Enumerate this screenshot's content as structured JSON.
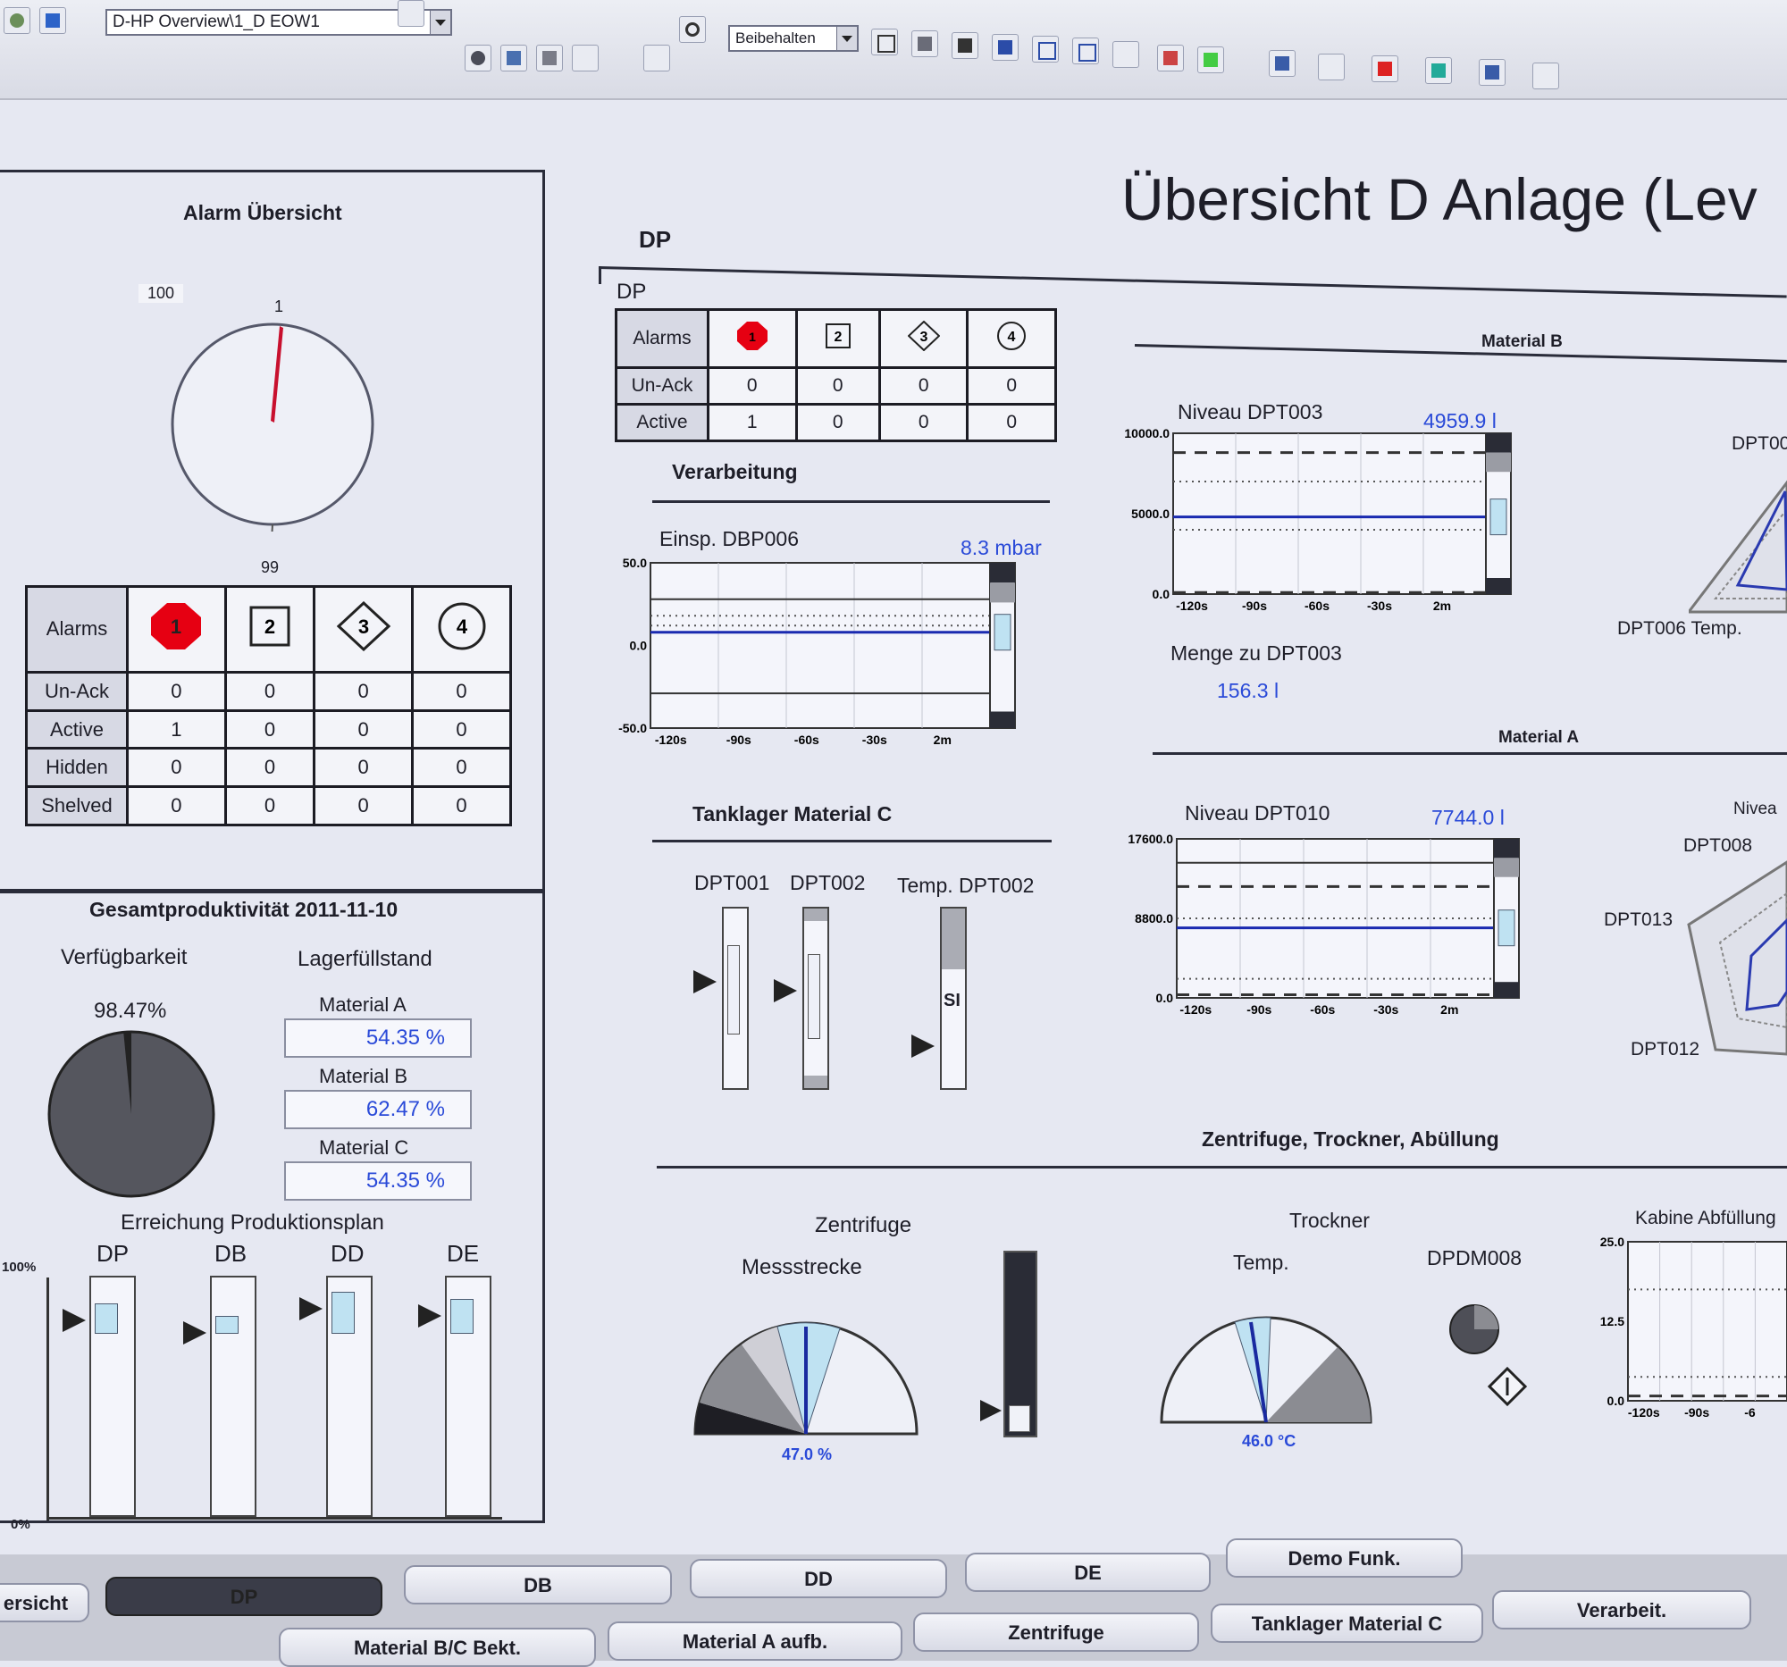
{
  "toolbar": {
    "screen_combo": "D-HP Overview\\1_D EOW1",
    "mode_combo": "Beibehalten"
  },
  "page_title": "Übersicht D Anlage (Lev",
  "alarm_overview": {
    "title": "Alarm Übersicht",
    "gauge_max": "100",
    "gauge_mark_top": "1",
    "gauge_mark_bottom": "99",
    "headers": [
      "Alarms",
      "1",
      "2",
      "3",
      "4"
    ],
    "rows": [
      {
        "label": "Un-Ack",
        "values": [
          "0",
          "0",
          "0",
          "0"
        ]
      },
      {
        "label": "Active",
        "values": [
          "1",
          "0",
          "0",
          "0"
        ]
      },
      {
        "label": "Hidden",
        "values": [
          "0",
          "0",
          "0",
          "0"
        ]
      },
      {
        "label": "Shelved",
        "values": [
          "0",
          "0",
          "0",
          "0"
        ]
      }
    ]
  },
  "productivity": {
    "title": "Gesamtproduktivität 2011-11-10",
    "availability_label": "Verfügbarkeit",
    "availability_value": "98.47%",
    "availability_fraction": 0.9847,
    "storage_label": "Lagerfüllstand",
    "materials": [
      {
        "name": "Material A",
        "value": "54.35 %"
      },
      {
        "name": "Material B",
        "value": "62.47 %"
      },
      {
        "name": "Material C",
        "value": "54.35 %"
      }
    ],
    "plan_title": "Erreichung Produktionsplan",
    "axis_top": "100%",
    "axis_bottom": "0%",
    "plan_bars": [
      {
        "name": "DP",
        "level": 0.9
      },
      {
        "name": "DB",
        "level": 0.85
      },
      {
        "name": "DD",
        "level": 0.95
      },
      {
        "name": "DE",
        "level": 0.92
      }
    ]
  },
  "dp": {
    "section_label": "DP",
    "box_label": "DP",
    "headers": [
      "Alarms",
      "1",
      "2",
      "3",
      "4"
    ],
    "rows": [
      {
        "label": "Un-Ack",
        "values": [
          "0",
          "0",
          "0",
          "0"
        ]
      },
      {
        "label": "Active",
        "values": [
          "1",
          "0",
          "0",
          "0"
        ]
      }
    ]
  },
  "verarbeitung": {
    "title": "Verarbeitung",
    "trend_label": "Einsp. DBP006",
    "trend_value": "8.3 mbar",
    "y_ticks": [
      "50.0",
      "0.0",
      "-50.0"
    ],
    "x_ticks": [
      "-120s",
      "-90s",
      "-60s",
      "-30s",
      "2m"
    ]
  },
  "tanklager": {
    "title": "Tanklager Material C",
    "labels": [
      "DPT001",
      "DPT002",
      "Temp. DPT002"
    ],
    "levels": [
      0.8,
      0.75,
      0.45
    ],
    "temp_marker": "SI"
  },
  "material_b": {
    "title": "Material B",
    "trend_label": "Niveau DPT003",
    "trend_value": "4959.9 l",
    "y_ticks": [
      "10000.0",
      "5000.0",
      "0.0"
    ],
    "x_ticks": [
      "-120s",
      "-90s",
      "-60s",
      "-30s",
      "2m"
    ],
    "menge_label": "Menge zu DPT003",
    "menge_value": "156.3 l",
    "radar_top": "DPT00",
    "radar_bottom": "DPT006 Temp."
  },
  "material_a": {
    "title": "Material A",
    "trend_label": "Niveau DPT010",
    "trend_value": "7744.0 l",
    "y_ticks": [
      "17600.0",
      "8800.0",
      "0.0"
    ],
    "x_ticks": [
      "-120s",
      "-90s",
      "-60s",
      "-30s",
      "2m"
    ],
    "radar_labels": [
      "Nivea",
      "DPT008",
      "DPT013",
      "DPT012"
    ]
  },
  "zentrifuge": {
    "section_title": "Zentrifuge, Trockner, Abüllung",
    "zentrifuge_label": "Zentrifuge",
    "messstrecke_label": "Messstrecke",
    "messstrecke_value": "47.0 %",
    "messstrecke_fraction": 0.47,
    "trockner_label": "Trockner",
    "temp_label": "Temp.",
    "temp_value": "46.0 °C",
    "dpdm_label": "DPDM008",
    "kabine_label": "Kabine Abfüllung",
    "kabine_y_ticks": [
      "25.0",
      "12.5",
      "0.0"
    ],
    "kabine_x_ticks": [
      "-120s",
      "-90s",
      "-6"
    ]
  },
  "nav": {
    "row1": [
      "ersicht",
      "DP",
      "DB",
      "DD",
      "DE",
      "Demo Funk."
    ],
    "row2": [
      "Material B/C Bekt.",
      "Material A aufb.",
      "Zentrifuge",
      "Tanklager Material C",
      "Verarbeit."
    ]
  }
}
